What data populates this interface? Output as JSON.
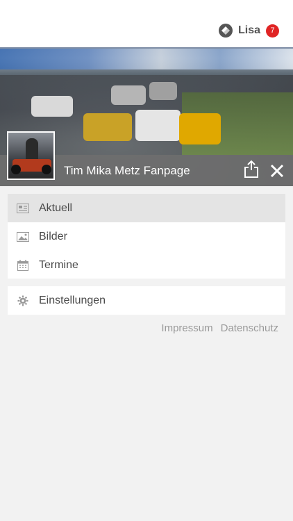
{
  "header": {
    "user_name": "Lisa",
    "notification_count": "7",
    "badge_color": "#e02424"
  },
  "banner": {
    "page_title": "Tim Mika Metz Fanpage",
    "share_icon": "share-icon",
    "close_icon": "close-icon"
  },
  "menu": {
    "items": [
      {
        "label": "Aktuell",
        "icon": "newspaper-icon",
        "active": true
      },
      {
        "label": "Bilder",
        "icon": "image-icon",
        "active": false
      },
      {
        "label": "Termine",
        "icon": "calendar-icon",
        "active": false
      }
    ],
    "settings": {
      "label": "Einstellungen",
      "icon": "gear-icon"
    }
  },
  "footer": {
    "impressum": "Impressum",
    "datenschutz": "Datenschutz"
  }
}
